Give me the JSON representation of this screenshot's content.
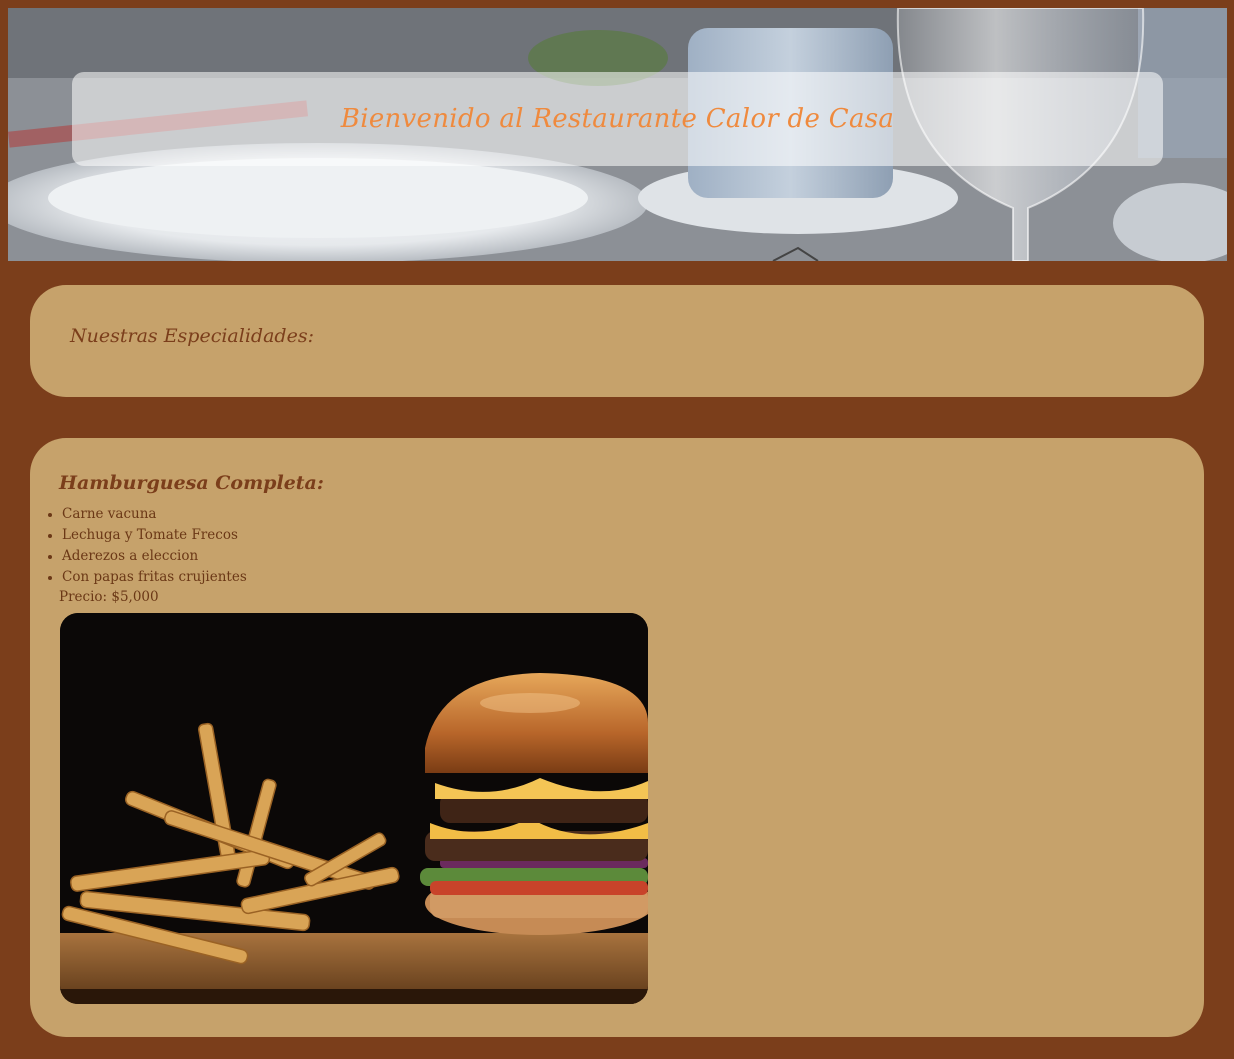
{
  "hero": {
    "title": "Bienvenido al Restaurante Calor de Casa"
  },
  "specialties": {
    "heading": "Nuestras Especialidades:"
  },
  "dish": {
    "name": "Hamburguesa Completa:",
    "ingredients": [
      "Carne vacuna",
      "Lechuga y Tomate Frecos",
      "Aderezos a eleccion",
      "Con papas fritas crujientes"
    ],
    "price": "Precio: $5,000"
  },
  "colors": {
    "page_background": "#7b3e1b",
    "card_background": "#c6a26b",
    "title_accent": "#ef8a3e",
    "text_brown": "#6b3816"
  },
  "images": {
    "hero": "table-setting-photo",
    "dish": "burger-and-fries-photo"
  }
}
